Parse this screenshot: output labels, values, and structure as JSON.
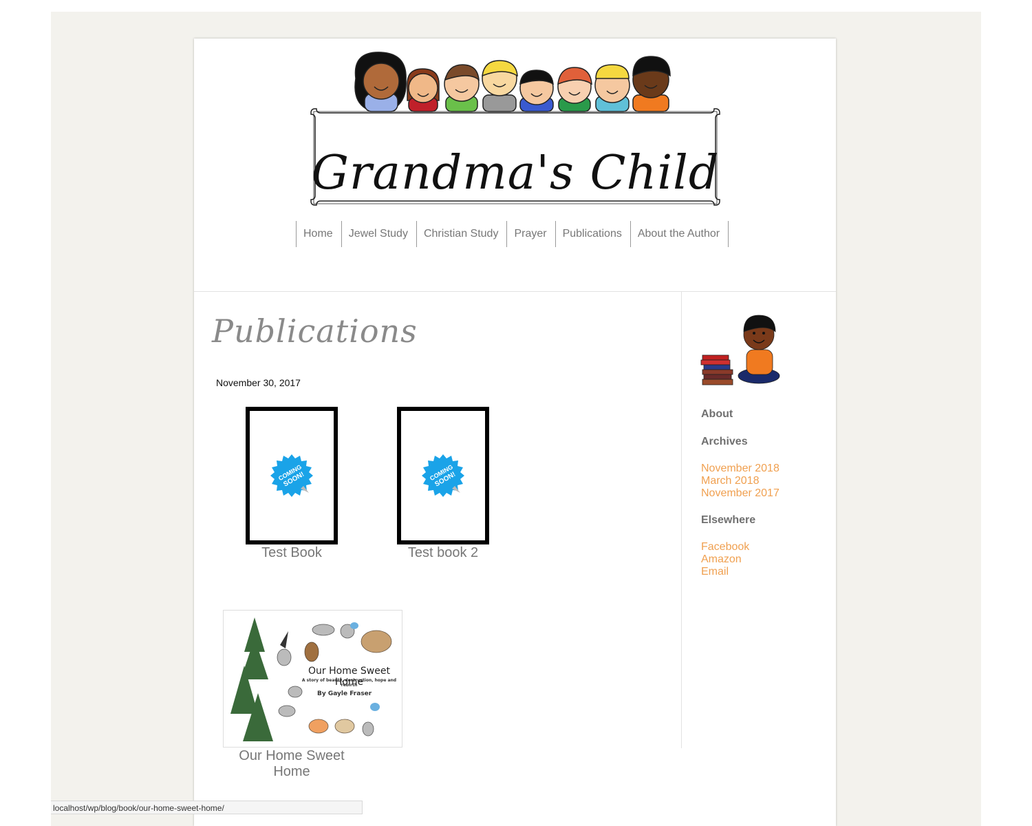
{
  "header": {
    "site_title": "Grandma's Child"
  },
  "nav": {
    "items": [
      "Home",
      "Jewel Study",
      "Christian Study",
      "Prayer",
      "Publications",
      "About the Author"
    ]
  },
  "main": {
    "page_title": "Publications",
    "date": "November 30, 2017",
    "books": [
      {
        "title": "Test Book",
        "badge": "COMING SOON!"
      },
      {
        "title": "Test book 2",
        "badge": "COMING SOON!"
      },
      {
        "title": "Our Home Sweet Home",
        "cover_title": "Our Home Sweet Home",
        "cover_subtitle": "A story of beauty, destruction, hope and rebirth",
        "cover_author": "By Gayle Fraser"
      }
    ]
  },
  "sidebar": {
    "about_heading": "About",
    "archives_heading": "Archives",
    "archives": [
      "November 2018",
      "March 2018",
      "November 2017"
    ],
    "elsewhere_heading": "Elsewhere",
    "elsewhere": [
      "Facebook",
      "Amazon",
      "Email"
    ]
  },
  "status_bar": {
    "url": "localhost/wp/blog/book/our-home-sweet-home/"
  },
  "colors": {
    "background": "#f3f2ed",
    "link": "#f0a050",
    "heading": "#707070",
    "badge": "#1aa3e8"
  }
}
